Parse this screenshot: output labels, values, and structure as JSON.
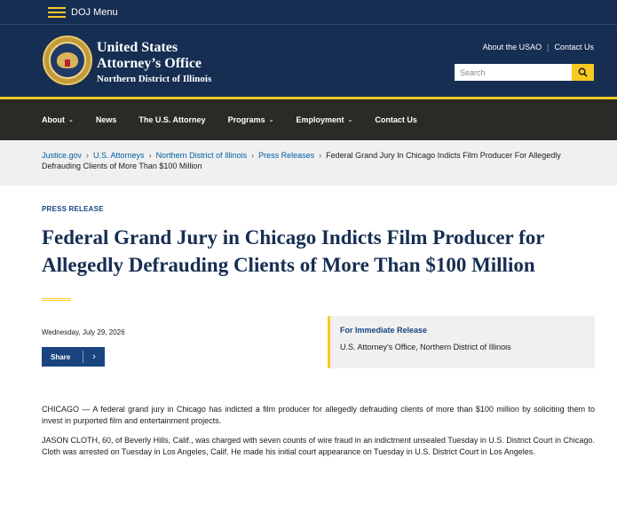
{
  "top_strip": {
    "menu_label": "DOJ Menu"
  },
  "masthead": {
    "office_line1": "United States",
    "office_line2": "Attorney’s Office",
    "office_line3": "Northern District of Illinois",
    "links": [
      "About the USAO",
      "Contact Us"
    ],
    "link_separator": "|",
    "search": {
      "placeholder": "Search"
    }
  },
  "nav": {
    "items": [
      {
        "label": "About",
        "has_dropdown": true
      },
      {
        "label": "News",
        "has_dropdown": false
      },
      {
        "label": "The U.S. Attorney",
        "has_dropdown": false
      },
      {
        "label": "Programs",
        "has_dropdown": true
      },
      {
        "label": "Employment",
        "has_dropdown": true
      },
      {
        "label": "Contact Us",
        "has_dropdown": false
      }
    ]
  },
  "breadcrumb": {
    "links": [
      "Justice.gov",
      "U.S. Attorneys",
      "Northern District of Illinois",
      "Press Releases"
    ],
    "current": "Federal Grand Jury In Chicago Indicts Film Producer For Allegedly Defrauding Clients of More Than $100 Million",
    "separator": "›"
  },
  "article": {
    "kicker": "PRESS RELEASE",
    "headline": "Federal Grand Jury in Chicago Indicts Film Producer for Allegedly Defrauding Clients of More Than $100 Million",
    "date": "Wednesday, July 29, 2026",
    "share_label": "Share",
    "share_arrow": "›",
    "release_title": "For Immediate Release",
    "release_office": "U.S. Attorney's Office, Northern District of Illinois",
    "paragraphs": [
      "CHICAGO — A federal grand jury in Chicago has indicted a film producer for allegedly defrauding clients of more than $100 million by soliciting them to invest in purported film and entertainment projects.",
      "JASON CLOTH, 60, of Beverly Hills, Calif., was charged with seven counts of wire fraud in an indictment unsealed Tuesday in U.S. District Court in Chicago.  Cloth was arrested on Tuesday in Los Angeles, Calif. He made his initial court appearance on Tuesday in U.S. District Court in Los Angeles."
    ]
  },
  "colors": {
    "navy": "#162e51",
    "gold": "#fac922",
    "dark_nav": "#2b2a26",
    "link_blue": "#005ea2",
    "accent_blue": "#1a4480"
  },
  "icons": {
    "menu": "hamburger-icon",
    "search": "magnifier-icon",
    "seal": "doj-seal",
    "share": "chevron-right-icon"
  }
}
